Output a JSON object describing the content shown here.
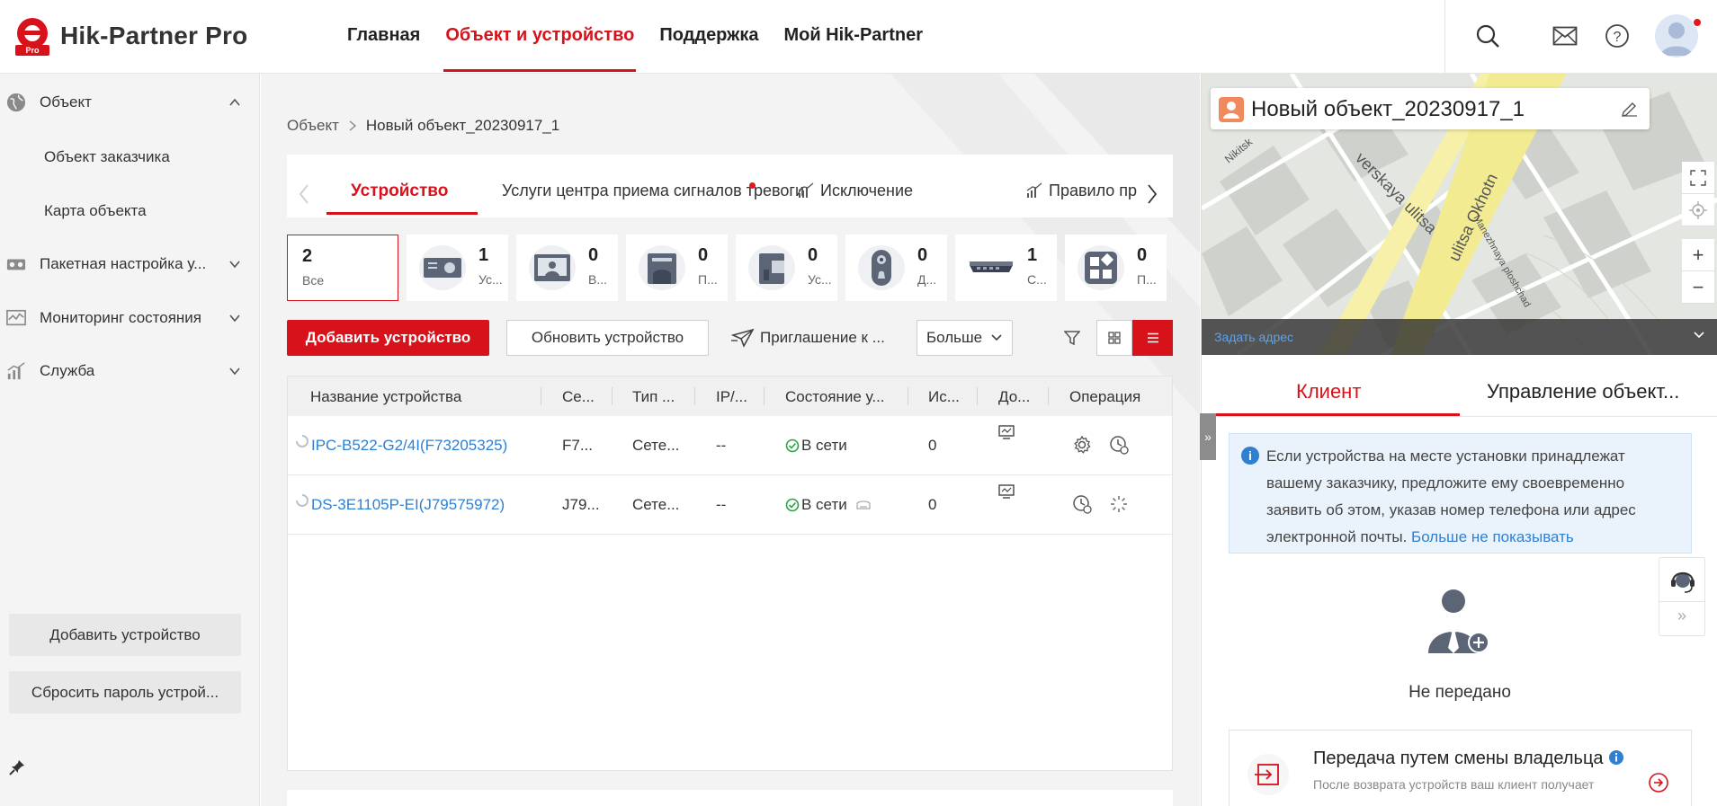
{
  "header": {
    "app_title": "Hik-Partner Pro",
    "logo_badge": "Pro",
    "nav": [
      "Главная",
      "Объект и устройство",
      "Поддержка",
      "Мой Hik-Partner"
    ],
    "nav_active_index": 1
  },
  "sidebar": {
    "object_label": "Объект",
    "sub_items": [
      "Объект заказчика",
      "Карта объекта"
    ],
    "batch_label": "Пакетная настройка у...",
    "monitoring_label": "Мониторинг состояния",
    "service_label": "Служба",
    "add_device_btn": "Добавить устройство",
    "reset_password_btn": "Сбросить пароль устрой..."
  },
  "main": {
    "breadcrumb": [
      "Объект",
      "Новый объект_20230917_1"
    ],
    "tabs": [
      "Устройство",
      "Услуги центра приема сигналов тревоги",
      "Исключение",
      "Правило пр"
    ],
    "cards": [
      {
        "count": "2",
        "label": "Все"
      },
      {
        "count": "1",
        "label": "Ус..."
      },
      {
        "count": "0",
        "label": "В..."
      },
      {
        "count": "0",
        "label": "П..."
      },
      {
        "count": "0",
        "label": "Ус..."
      },
      {
        "count": "0",
        "label": "Д..."
      },
      {
        "count": "1",
        "label": "С..."
      },
      {
        "count": "0",
        "label": "П..."
      }
    ],
    "toolbar": {
      "add": "Добавить устройство",
      "update": "Обновить устройство",
      "invite": "Приглашение к ...",
      "more": "Больше"
    },
    "columns": [
      "Название устройства",
      "Се...",
      "Тип ...",
      "IP/...",
      "Состояние у...",
      "Ис...",
      "До...",
      "Операция"
    ],
    "rows": [
      {
        "name": "IPC-B522-G2/4I(F73205325)",
        "serial": "F7...",
        "type": "Сете...",
        "ip": "--",
        "status": "В сети",
        "is": "0"
      },
      {
        "name": "DS-3E1105P-EI(J79575972)",
        "serial": "J79...",
        "type": "Сете...",
        "ip": "--",
        "status": "В сети",
        "is": "0"
      }
    ]
  },
  "right": {
    "object_name": "Новый объект_20230917_1",
    "map_address_link": "Задать адрес",
    "map_streets": [
      "verskaya ulitsa",
      "ulitsa Okhotn",
      "Manezhnaya ploshchad",
      "Nikitsk"
    ],
    "tabs": [
      "Клиент",
      "Управление объект..."
    ],
    "notice_text": "Если устройства на месте установки принадлежат вашему заказчику, предложите ему своевременно заявить об этом, указав номер телефона или адрес электронной почты. ",
    "notice_link": "Больше не показывать",
    "no_owner": "Не передано",
    "transfer_title": "Передача путем смены владельца",
    "transfer_sub": "После возврата устройств ваш клиент получает"
  },
  "colors": {
    "accent": "#d7121b",
    "link": "#2f80d1",
    "online": "#2aa344"
  }
}
